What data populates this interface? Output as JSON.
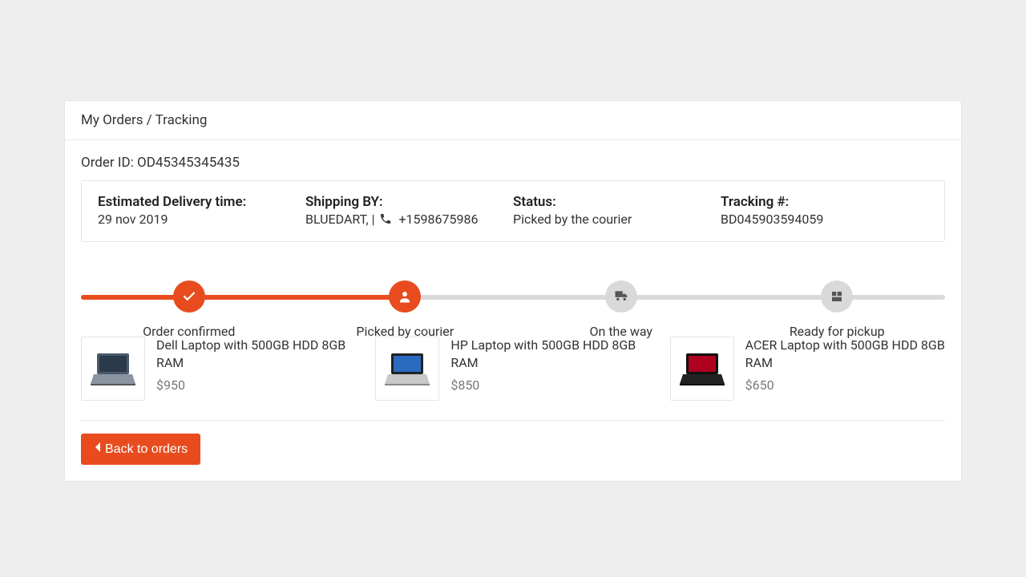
{
  "colors": {
    "accent": "#e84c1e"
  },
  "header": {
    "breadcrumb": "My Orders / Tracking"
  },
  "order": {
    "id_label": "Order ID:",
    "id_value": "OD45345345435",
    "delivery_label": "Estimated Delivery time:",
    "delivery_value": "29 nov 2019",
    "shipping_label": "Shipping BY:",
    "shipping_company": "BLUEDART,",
    "shipping_phone": "+1598675986",
    "status_label": "Status:",
    "status_value": "Picked by the courier",
    "tracking_label": "Tracking #:",
    "tracking_value": "BD045903594059"
  },
  "progress": {
    "active_index": 1,
    "steps": [
      {
        "label": "Order confirmed",
        "icon": "check"
      },
      {
        "label": "Picked by courier",
        "icon": "user"
      },
      {
        "label": "On the way",
        "icon": "truck"
      },
      {
        "label": "Ready for pickup",
        "icon": "box"
      }
    ]
  },
  "items": [
    {
      "title": "Dell Laptop with 500GB HDD 8GB RAM",
      "price": "$950"
    },
    {
      "title": "HP Laptop with 500GB HDD 8GB RAM",
      "price": "$850"
    },
    {
      "title": "ACER Laptop with 500GB HDD 8GB RAM",
      "price": "$650"
    }
  ],
  "back_button": "Back to orders"
}
